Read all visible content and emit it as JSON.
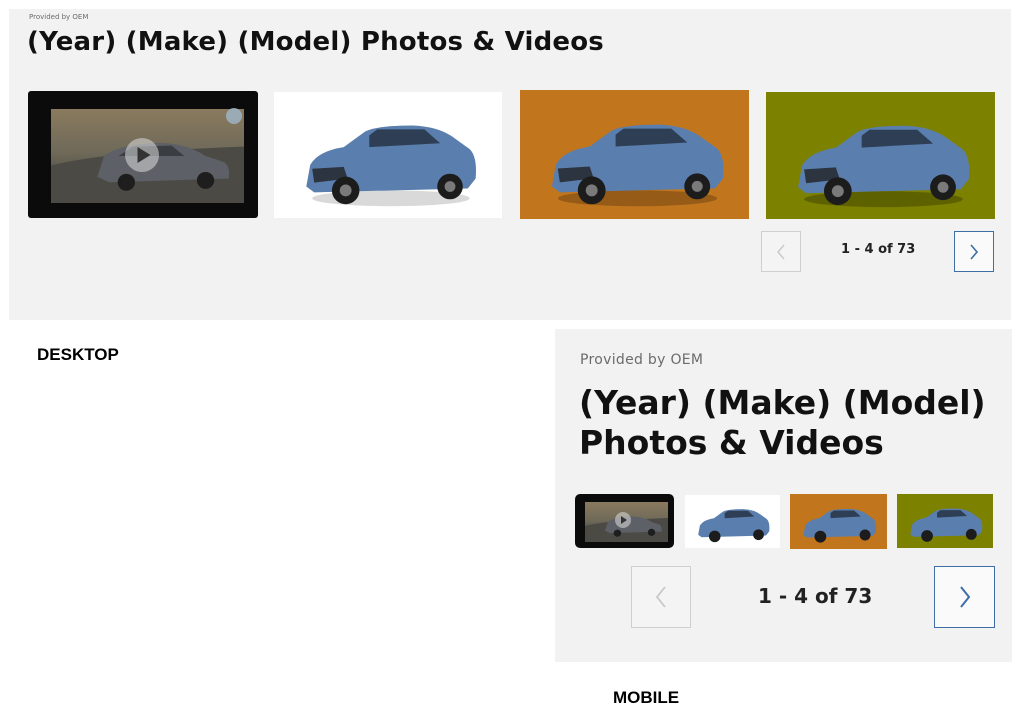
{
  "desktop": {
    "provided_by": "Provided by OEM",
    "title": "(Year) (Make) (Model) Photos & Videos",
    "pagination": "1 - 4 of 73",
    "thumbnails": [
      {
        "type": "video",
        "background": "#0b0b0b"
      },
      {
        "type": "photo",
        "background": "#ffffff"
      },
      {
        "type": "photo",
        "background": "#c1761e"
      },
      {
        "type": "photo",
        "background": "#7d8100"
      }
    ],
    "label": "DESKTOP"
  },
  "mobile": {
    "provided_by": "Provided by OEM",
    "title": "(Year) (Make) (Model) Photos & Videos",
    "pagination": "1 - 4 of 73",
    "label": "MOBILE"
  },
  "colors": {
    "panel_bg": "#f2f2f2",
    "car_body": "#5a7fae",
    "next_button": "#3d6ea6",
    "prev_button": "#c8c8c8"
  },
  "icons": {
    "prev": "chevron-left-icon",
    "next": "chevron-right-icon",
    "play": "play-icon"
  }
}
